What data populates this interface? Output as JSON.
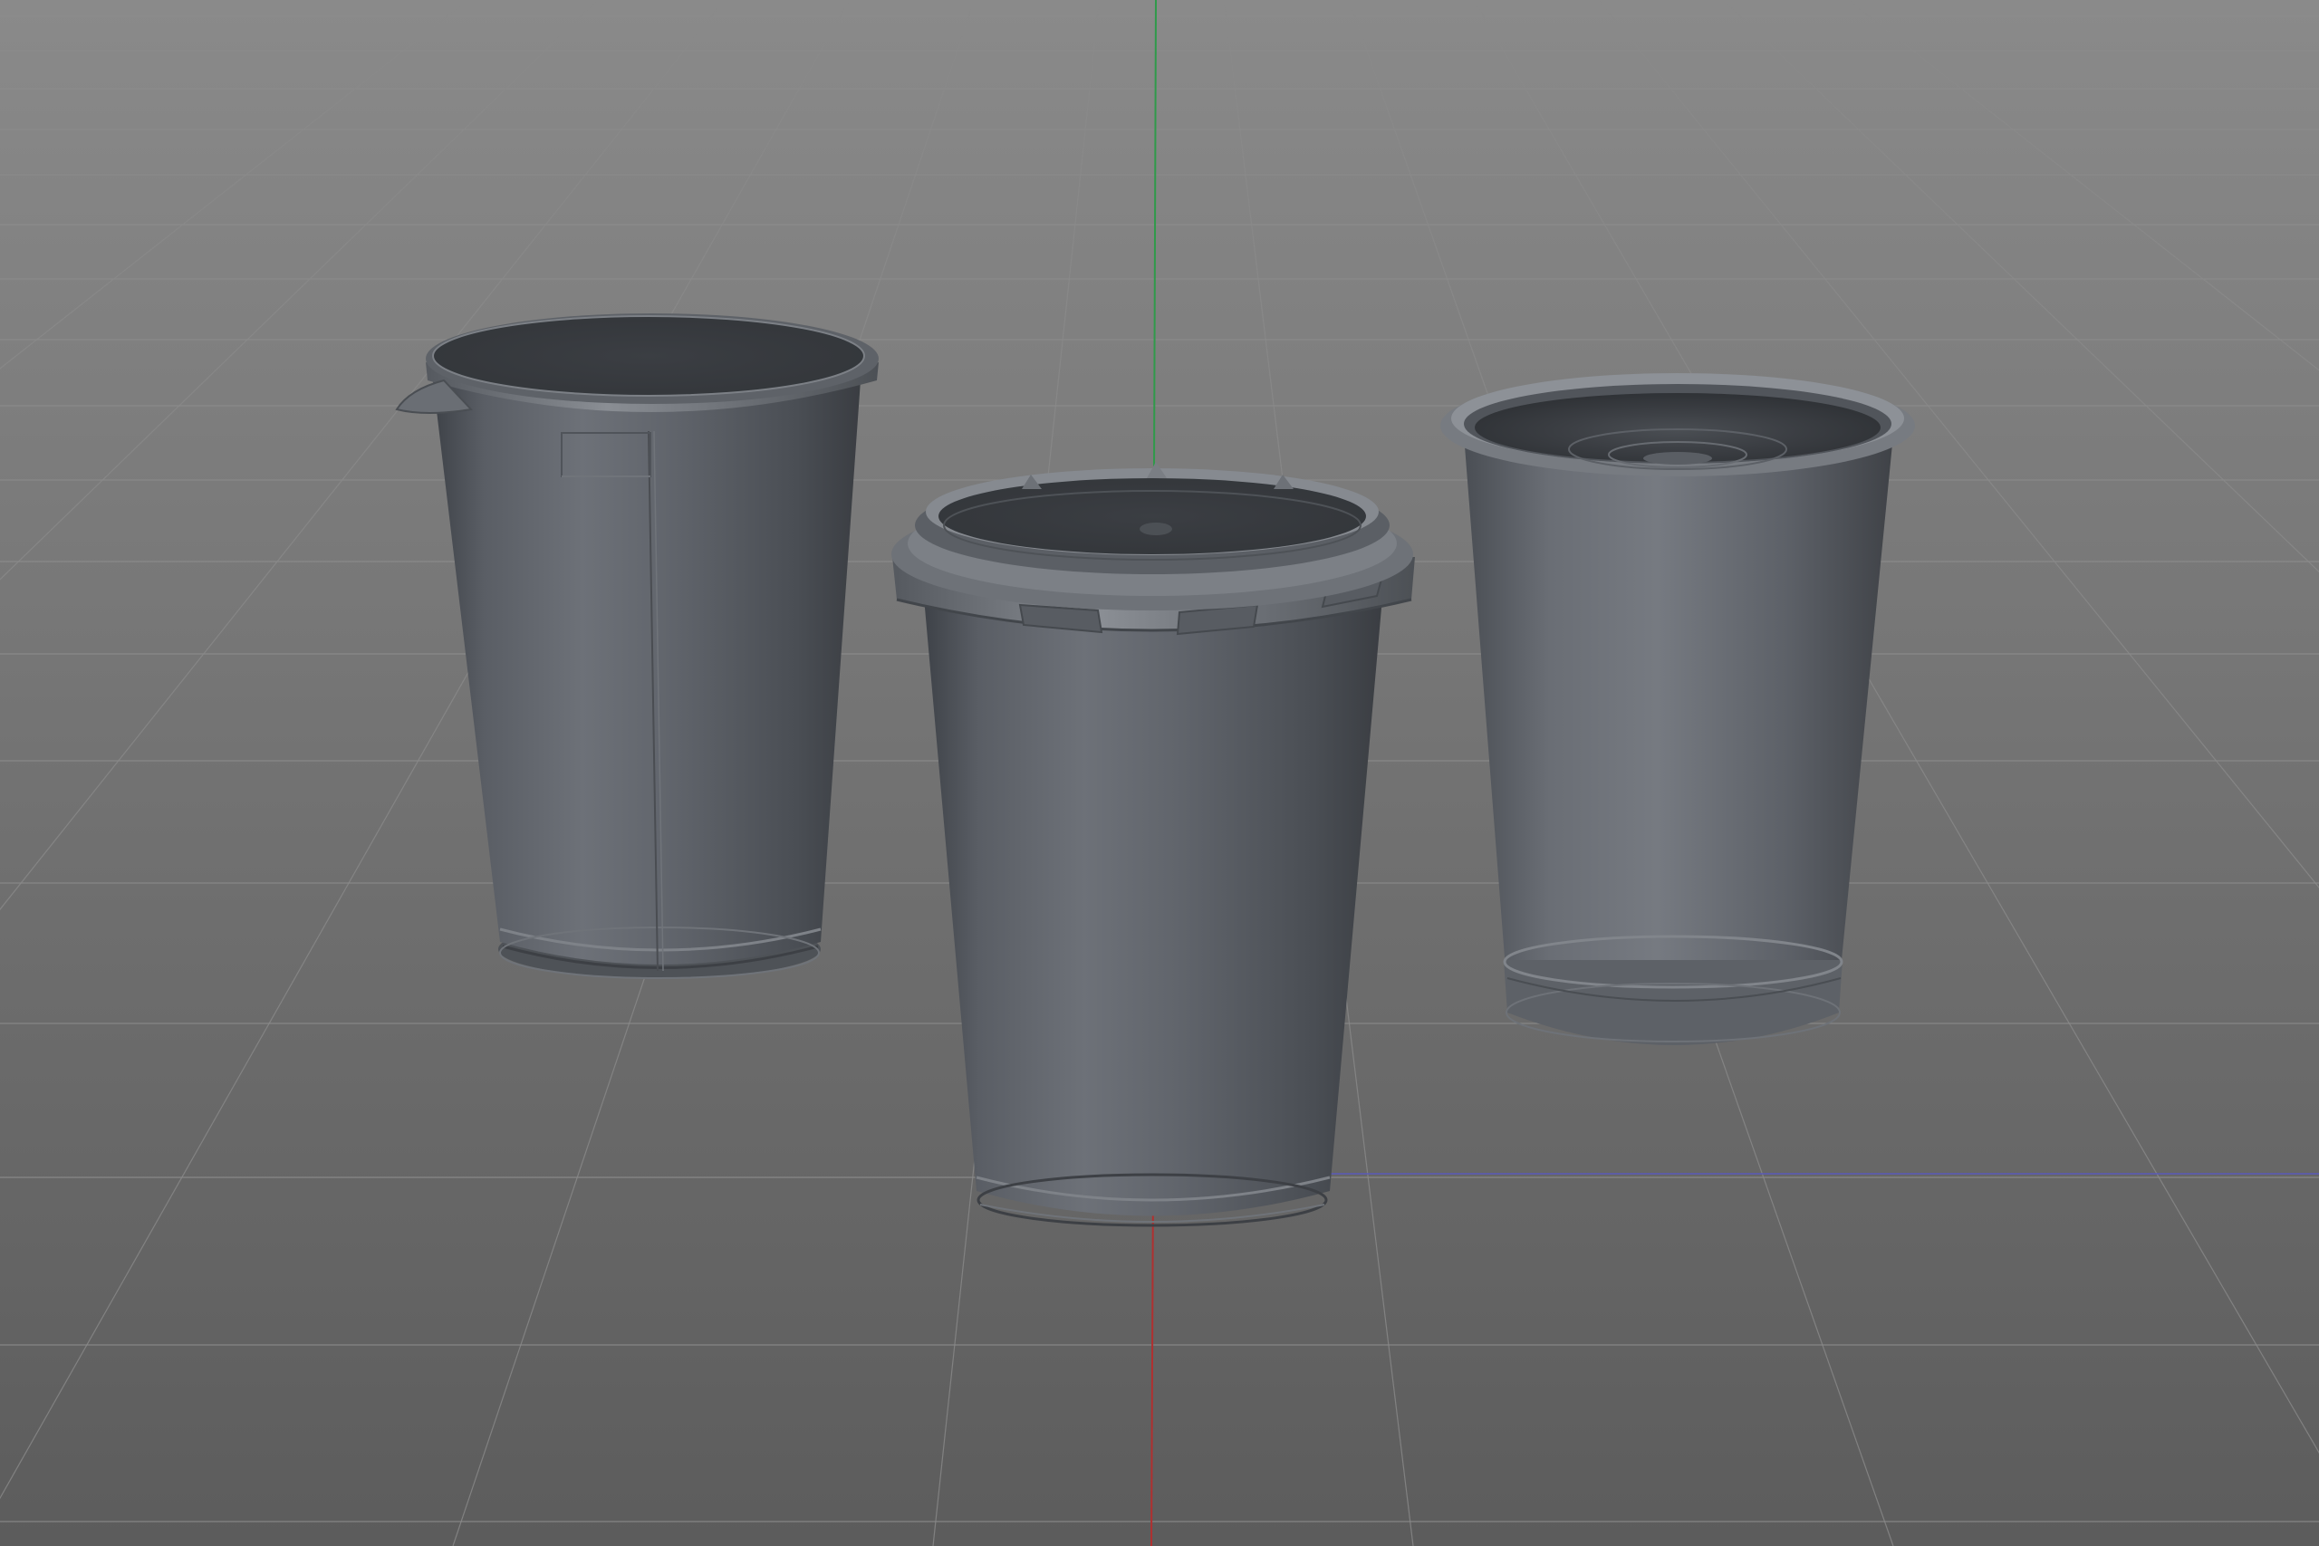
{
  "viewport": {
    "background_top": "#858585",
    "background_bottom": "#5e5e5e",
    "grid_color": "#7a7a7a",
    "grid_color_far": "#8c8c8c"
  },
  "axes": {
    "y_axis_color": "#2f9a4a",
    "z_axis_color": "#b03030",
    "x_axis_color": "#5a5ab8"
  },
  "objects": [
    {
      "name": "cup-with-foil-lid",
      "color": "#5c6066"
    },
    {
      "name": "cup-with-snap-lid",
      "color": "#5c6066"
    },
    {
      "name": "open-cup",
      "color": "#5c6066"
    }
  ]
}
